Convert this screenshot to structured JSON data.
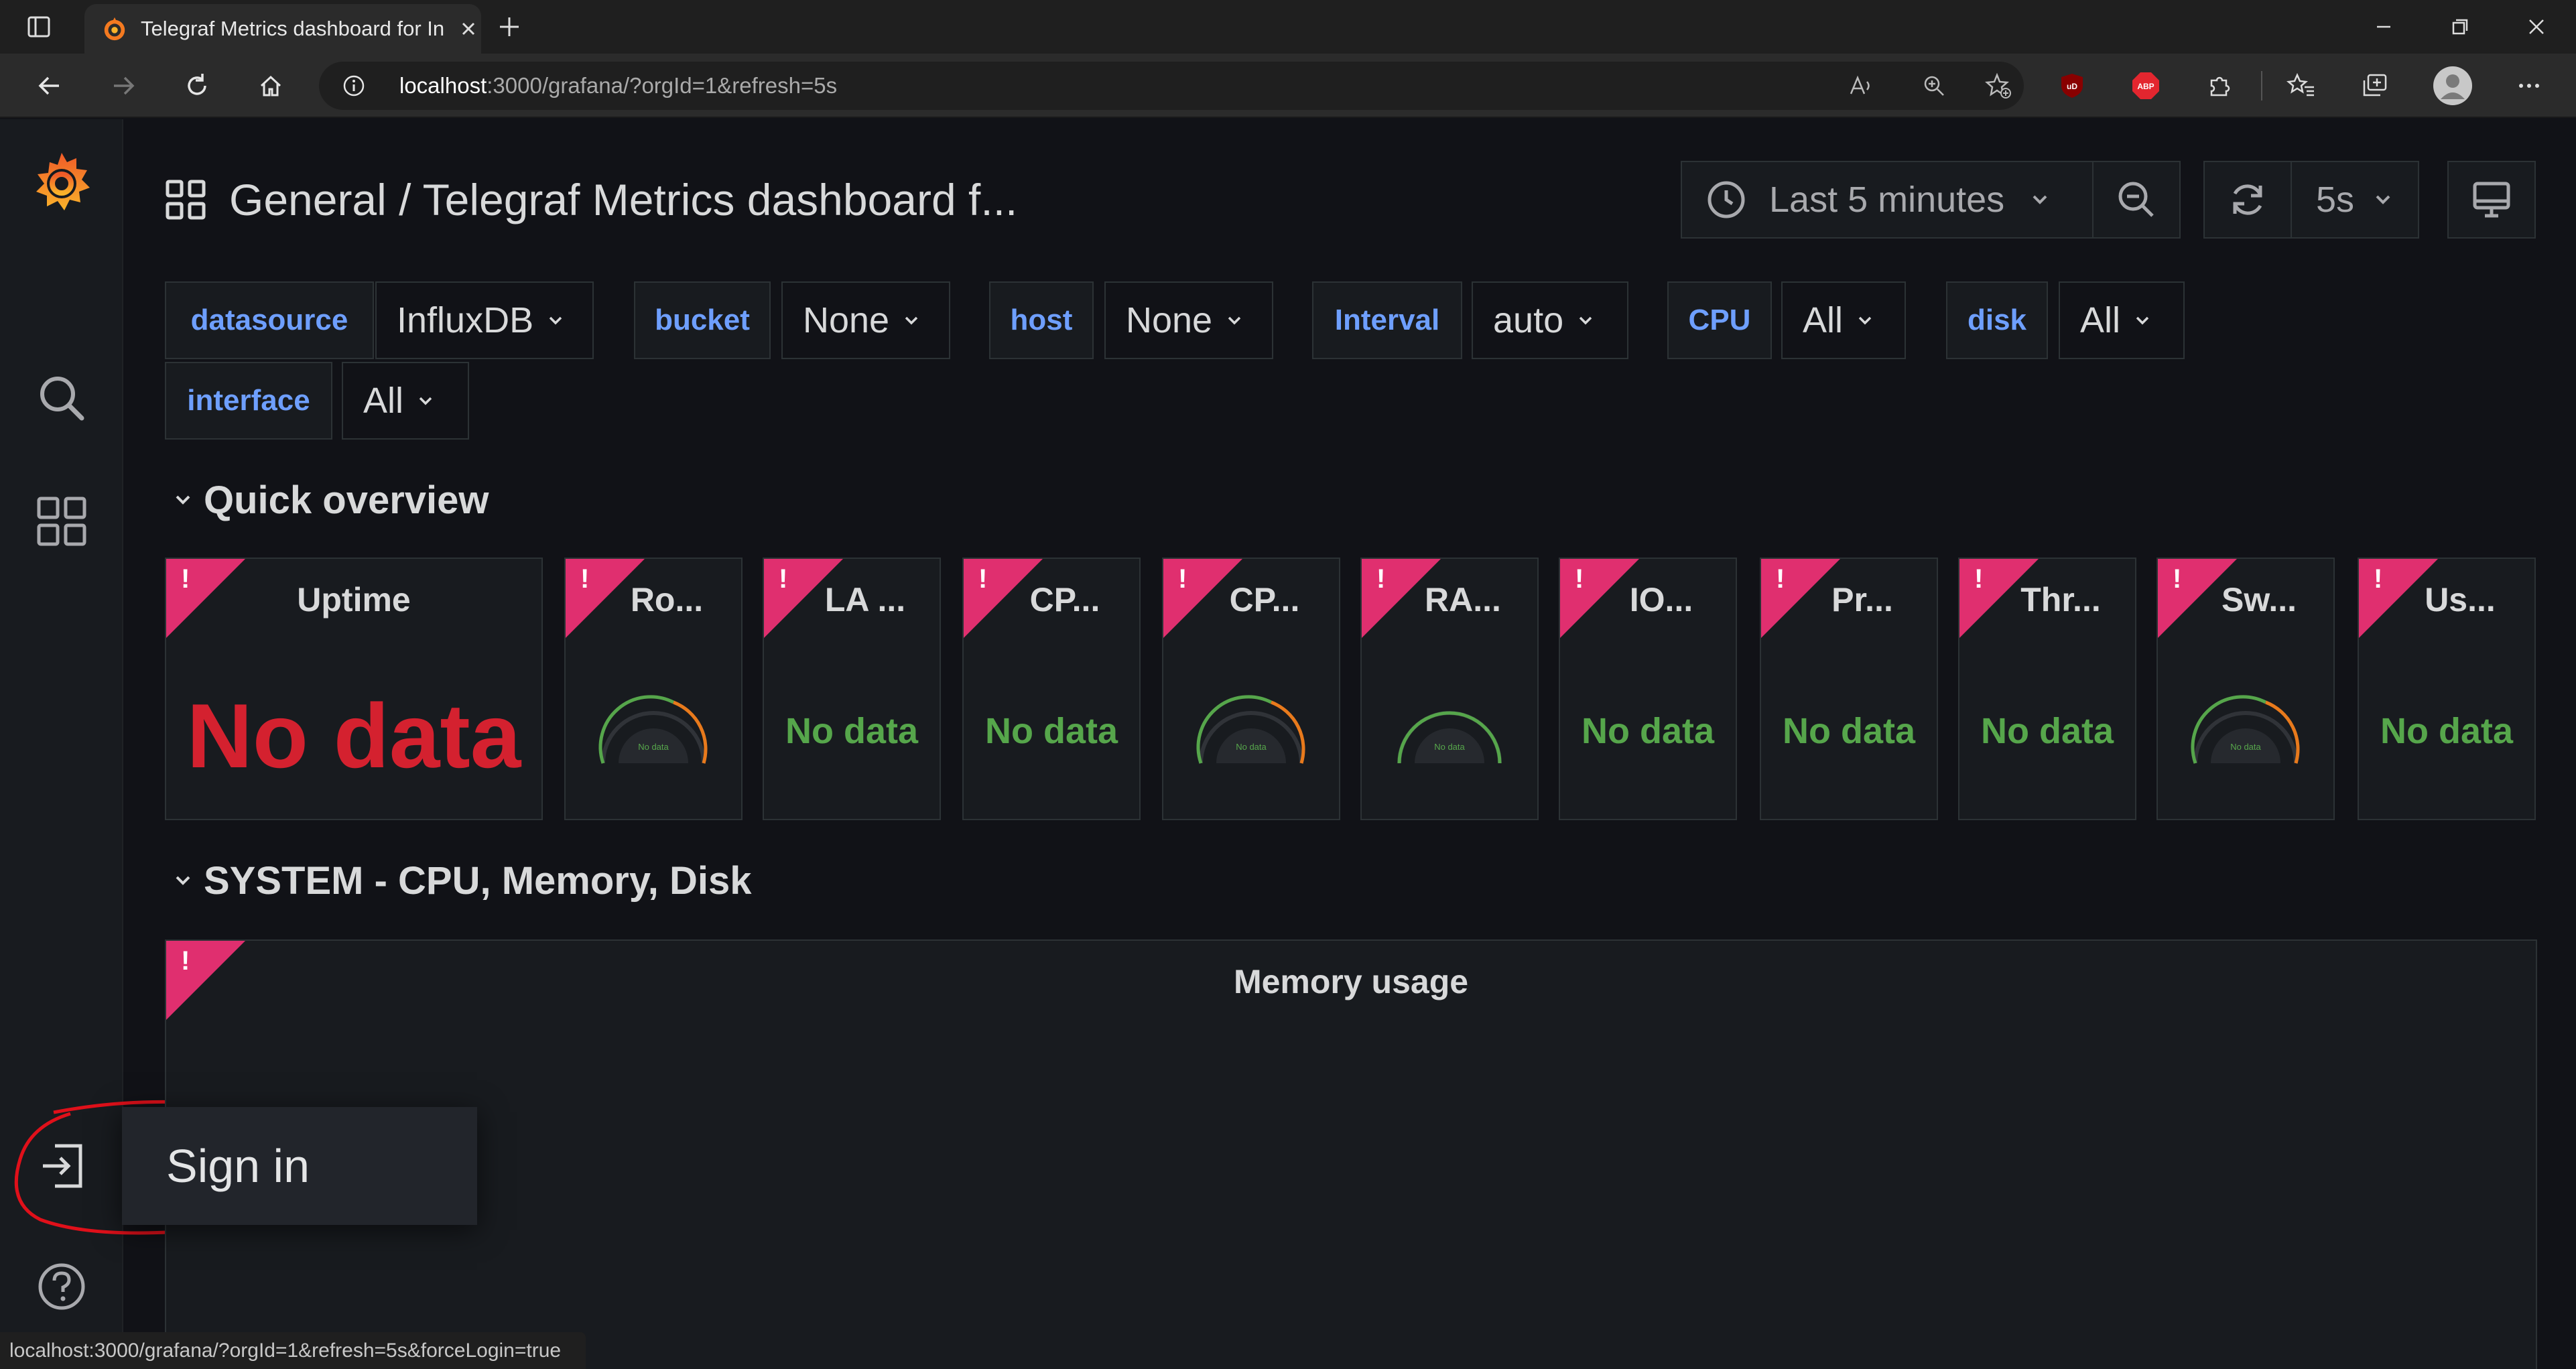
{
  "browser": {
    "tab_title": "Telegraf Metrics dashboard for In",
    "url_host": "localhost",
    "url_rest": ":3000/grafana/?orgId=1&refresh=5s",
    "status_url": "localhost:3000/grafana/?orgId=1&refresh=5s&forceLogin=true",
    "extensions": {
      "ublock": "uD",
      "abp": "ABP"
    }
  },
  "header": {
    "breadcrumb": "General  / Telegraf Metrics dashboard f...",
    "time_range": "Last 5 minutes",
    "refresh_interval": "5s"
  },
  "variables": [
    {
      "label": "datasource",
      "value": "InfluxDB"
    },
    {
      "label": "bucket",
      "value": "None"
    },
    {
      "label": "host",
      "value": "None"
    },
    {
      "label": "Interval",
      "value": "auto"
    },
    {
      "label": "CPU",
      "value": "All"
    },
    {
      "label": "disk",
      "value": "All"
    },
    {
      "label": "interface",
      "value": "All"
    }
  ],
  "rows": {
    "quick_overview": "Quick overview",
    "system": "SYSTEM - CPU, Memory, Disk"
  },
  "panels": [
    {
      "title": "Uptime",
      "value": "No data"
    },
    {
      "title": "Ro...",
      "value": "No data"
    },
    {
      "title": "LA ...",
      "value": "No data"
    },
    {
      "title": "CP...",
      "value": "No data"
    },
    {
      "title": "CP...",
      "value": "No data"
    },
    {
      "title": "RA...",
      "value": "No data"
    },
    {
      "title": "IO...",
      "value": "No data"
    },
    {
      "title": "Pr...",
      "value": "No data"
    },
    {
      "title": "Thr...",
      "value": "No data"
    },
    {
      "title": "Sw...",
      "value": "No data"
    },
    {
      "title": "Us...",
      "value": "No data"
    }
  ],
  "memory_panel": {
    "title": "Memory usage"
  },
  "panel_warning_mark": "!",
  "signin": {
    "label": "Sign in"
  },
  "colors": {
    "background": "#111217",
    "panel": "#181b1f",
    "variable_label": "#6e9fff",
    "nodata_green": "#56a64b",
    "nodata_red": "#d4212f",
    "warning_corner": "#e02f6f",
    "annotation_circle": "#e0101a"
  }
}
